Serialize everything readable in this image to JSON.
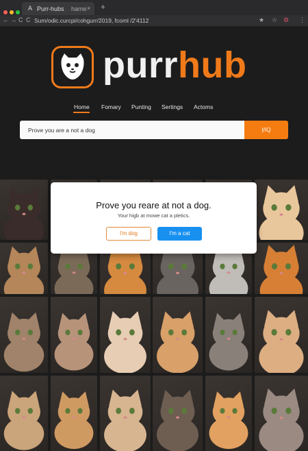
{
  "browser": {
    "tab_icon": "A",
    "tab_title": "Purr-hubs",
    "tab_hint": "hame",
    "tab_close": "×",
    "new_tab": "+",
    "nav": [
      "←",
      "→",
      "C",
      "C"
    ],
    "url": "Sum/odic.curcpi/cohgurr/2019, fcoml /2'4112",
    "right_icons": [
      "★",
      "☆",
      "⚙",
      "⋮"
    ]
  },
  "brand": {
    "name_part1": "purr",
    "name_part2": "hub",
    "accent": "#f07a1a"
  },
  "nav": {
    "items": [
      "Home",
      "Fomary",
      "Punting",
      "Sertings",
      "Actoms"
    ],
    "active": "Home"
  },
  "search": {
    "value": "Prove you are a not a dog",
    "button_label": "|/IQ"
  },
  "modal": {
    "title": "Prove you reare at not a dog.",
    "subtitle": "Your higb at mowe cat a pletics.",
    "dog_button": "I'm dog",
    "cat_button": "I'm a cat",
    "cat_button_color": "#1890f0"
  },
  "grid": {
    "cell_colors": [
      "#3a2c2a",
      "#8a7560",
      "#cfa07a",
      "#c7905a",
      "#d8b070",
      "#e9c79c",
      "#b4865a",
      "#7b6a58",
      "#d58a40",
      "#6a6460",
      "#c0bcb8",
      "#d67f35",
      "#a0836a",
      "#b7937a",
      "#e7cdb4",
      "#d9a06a",
      "#8a807a",
      "#dcae82",
      "#caa47a",
      "#cf9a62",
      "#d7b590",
      "#6e5e52",
      "#e2a160",
      "#9a8a82"
    ]
  }
}
